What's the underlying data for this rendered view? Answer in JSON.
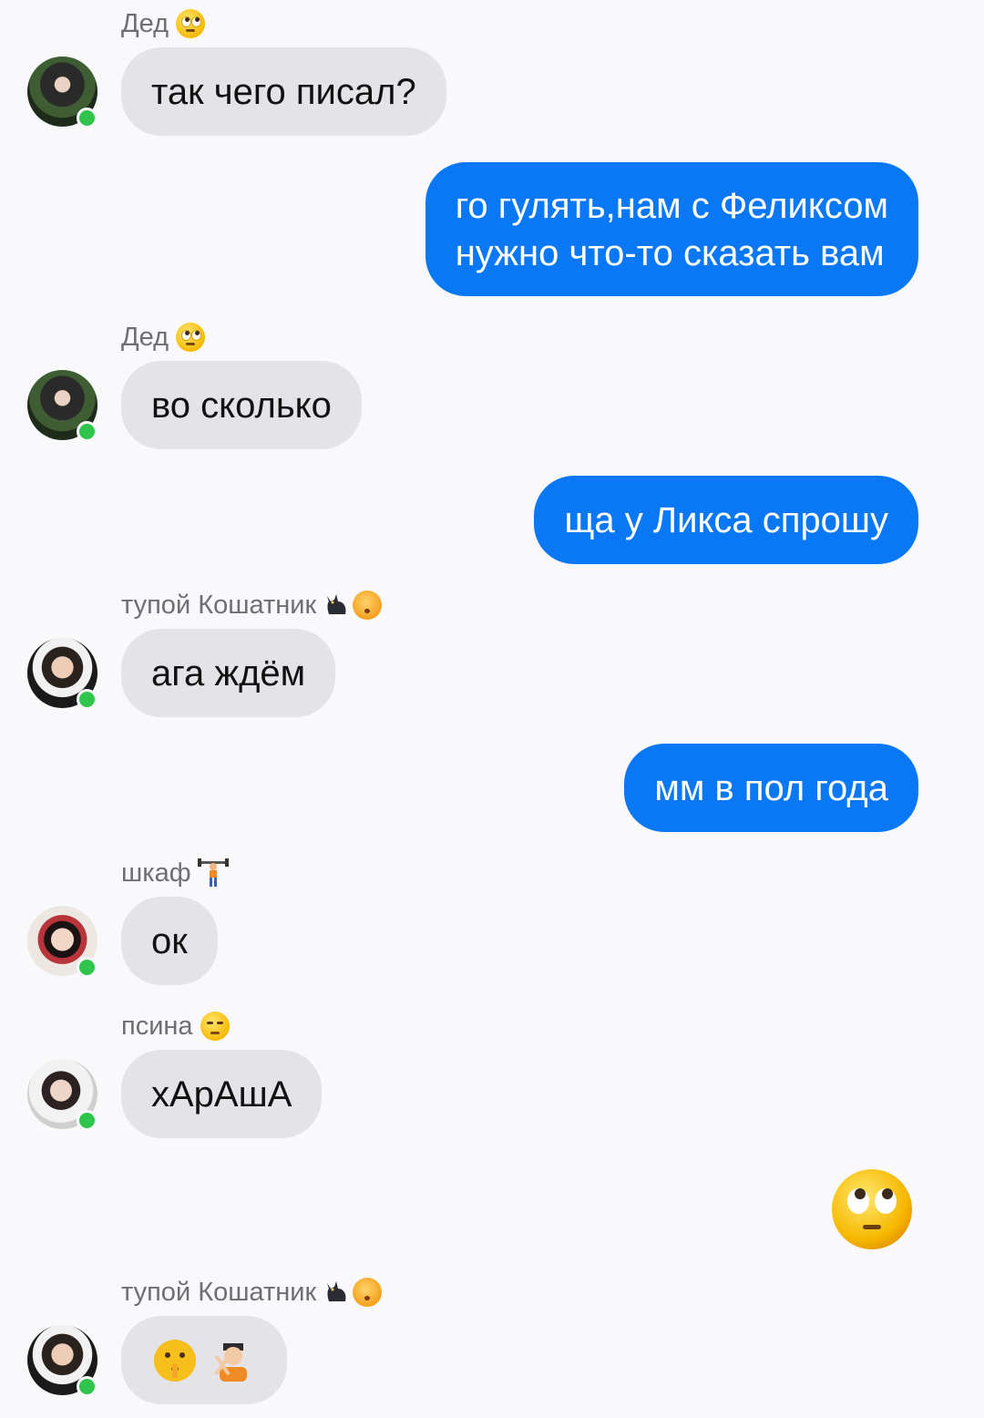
{
  "messages": [
    {
      "sender": "Дед",
      "sender_emoji": "face-with-rolling-eyes",
      "text": "так чего писал?"
    },
    {
      "text": "го гулять,нам с Феликсом нужно что-то сказать вам",
      "lines": [
        "го гулять,нам с Феликсом",
        "нужно что-то сказать вам"
      ]
    },
    {
      "sender": "Дед",
      "sender_emoji": "face-with-rolling-eyes",
      "text": "во сколько"
    },
    {
      "text": "ща у Ликса спрошу"
    },
    {
      "sender": "тупой Кошатник",
      "sender_emoji": "black-cat, kissing-cat",
      "text": "ага ждём"
    },
    {
      "text": "мм в пол года"
    },
    {
      "sender": "шкаф",
      "sender_emoji": "person-lifting-weights",
      "text": "ок"
    },
    {
      "sender": "псина",
      "sender_emoji": "unamused-face",
      "text": "хАрАшА"
    },
    {
      "emoji": "face-with-rolling-eyes"
    },
    {
      "sender": "тупой Кошатник",
      "sender_emoji": "black-cat, kissing-cat",
      "emojis": [
        "shushing-face",
        "person-gesturing-no"
      ]
    }
  ],
  "colors": {
    "outgoing_bubble": "#0a78f4",
    "incoming_bubble": "#e4e4e8",
    "online_dot": "#2fc54c",
    "sender_name": "#6f6f72"
  }
}
